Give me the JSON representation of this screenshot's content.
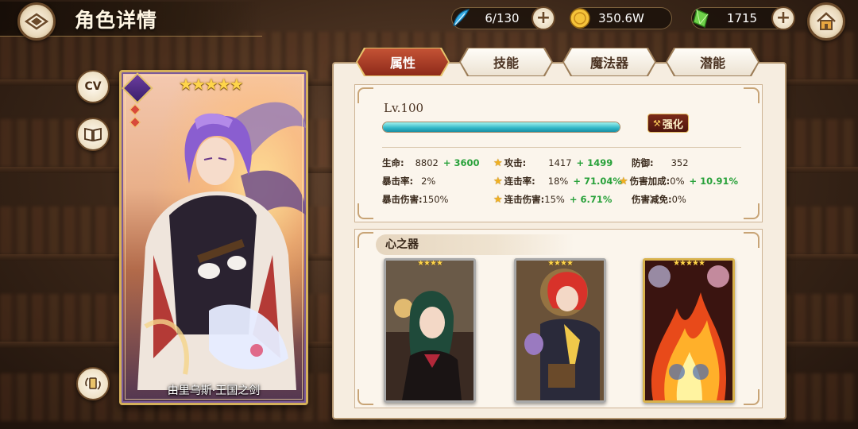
{
  "header": {
    "title": "角色详情",
    "back_icon": "diamond-back-icon",
    "home_icon": "house-icon"
  },
  "resources": [
    {
      "name": "stamina",
      "icon": "blue-feather-icon",
      "value": "6/130",
      "has_plus": true
    },
    {
      "name": "gold",
      "icon": "gold-coin-icon",
      "value": "350.6W",
      "has_plus": false
    },
    {
      "name": "gem",
      "icon": "green-crystal-icon",
      "value": "1715",
      "has_plus": true
    }
  ],
  "side_buttons": {
    "cv_label": "CV",
    "book_icon": "book-icon",
    "swap_icon": "swap-card-icon"
  },
  "character": {
    "name": "由里乌斯·王国之剑",
    "stars": "★★★★★",
    "rarity_stars": 5
  },
  "tabs": [
    {
      "label": "属性",
      "active": true
    },
    {
      "label": "技能",
      "active": false
    },
    {
      "label": "魔法器",
      "active": false
    },
    {
      "label": "潜能",
      "active": false
    }
  ],
  "attributes": {
    "level": "Lv.100",
    "exp_percent": 100,
    "enhance_label": "强化",
    "stats": [
      {
        "label": "生命:",
        "value": "8802",
        "bonus": "+ 3600",
        "star": false
      },
      {
        "label": "攻击:",
        "value": "1417",
        "bonus": "+ 1499",
        "star": true
      },
      {
        "label": "防御:",
        "value": "352",
        "bonus": "",
        "star": false
      },
      {
        "label": "暴击率:",
        "value": "2%",
        "bonus": "",
        "star": false
      },
      {
        "label": "连击率:",
        "value": "18%",
        "bonus": "+ 71.04%",
        "star": true
      },
      {
        "label": "伤害加成:",
        "value": "0%",
        "bonus": "+ 10.91%",
        "star": true
      },
      {
        "label": "暴击伤害:",
        "value": "150%",
        "bonus": "",
        "star": false
      },
      {
        "label": "连击伤害:",
        "value": "15%",
        "bonus": "+ 6.71%",
        "star": true
      },
      {
        "label": "伤害减免:",
        "value": "0%",
        "bonus": "",
        "star": false
      }
    ]
  },
  "heart_vessel": {
    "title": "心之器",
    "cards": [
      {
        "stars": "★★★★",
        "frame": "silver",
        "subject": "green-haired-woman-card"
      },
      {
        "stars": "★★★★",
        "frame": "silver",
        "subject": "red-haired-man-card"
      },
      {
        "stars": "★★★★★",
        "frame": "gold",
        "subject": "fire-twins-card"
      }
    ]
  },
  "colors": {
    "accent_red": "#a33a22",
    "bonus_green": "#28a13a",
    "exp_cyan": "#2fb6c6",
    "panel_bg": "#f6ede0",
    "gold": "#e7c36c"
  }
}
